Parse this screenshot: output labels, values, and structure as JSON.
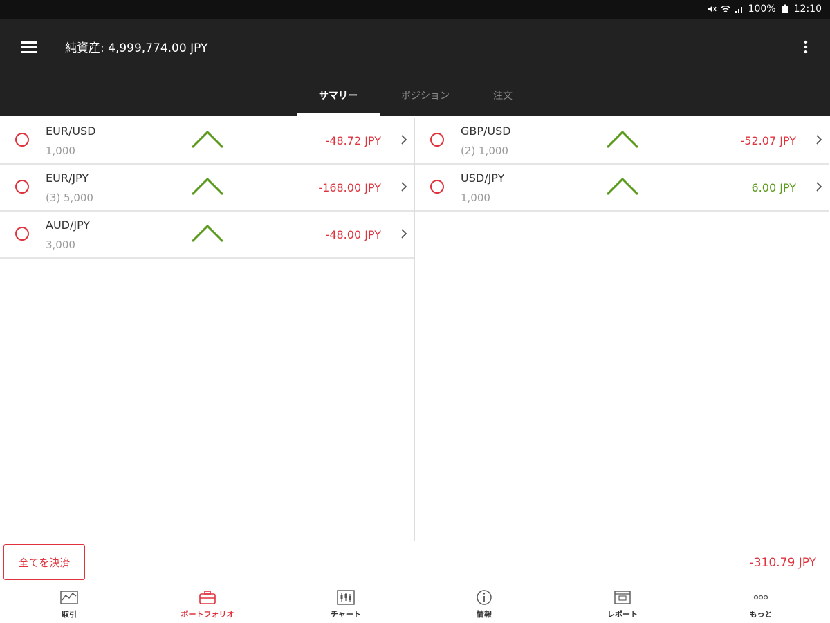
{
  "status_bar": {
    "battery": "100%",
    "time": "12:10"
  },
  "header": {
    "title": "純資産: 4,999,774.00 JPY"
  },
  "tabs": [
    {
      "label": "サマリー",
      "active": true
    },
    {
      "label": "ポジション",
      "active": false
    },
    {
      "label": "注文",
      "active": false
    }
  ],
  "positions_left": [
    {
      "pair": "EUR/USD",
      "quantity": "1,000",
      "pl": "-48.72 JPY",
      "pl_sign": "negative"
    },
    {
      "pair": "EUR/JPY",
      "quantity": "(3) 5,000",
      "pl": "-168.00 JPY",
      "pl_sign": "negative"
    },
    {
      "pair": "AUD/JPY",
      "quantity": "3,000",
      "pl": "-48.00 JPY",
      "pl_sign": "negative"
    }
  ],
  "positions_right": [
    {
      "pair": "GBP/USD",
      "quantity": "(2) 1,000",
      "pl": "-52.07 JPY",
      "pl_sign": "negative"
    },
    {
      "pair": "USD/JPY",
      "quantity": "1,000",
      "pl": "6.00 JPY",
      "pl_sign": "positive"
    }
  ],
  "footer": {
    "close_all_label": "全てを決済",
    "total_pl": "-310.79 JPY"
  },
  "bottom_nav": [
    {
      "label": "取引",
      "icon": "trade-icon",
      "active": false
    },
    {
      "label": "ポートフォリオ",
      "icon": "briefcase-icon",
      "active": true
    },
    {
      "label": "チャート",
      "icon": "chart-icon",
      "active": false
    },
    {
      "label": "情報",
      "icon": "info-icon",
      "active": false
    },
    {
      "label": "レポート",
      "icon": "report-icon",
      "active": false
    },
    {
      "label": "もっと",
      "icon": "more-dots-icon",
      "active": false
    }
  ],
  "colors": {
    "negative": "#e0323c",
    "positive": "#5a9a1a",
    "trend_up": "#5a9a1a",
    "appbar": "#222222"
  }
}
